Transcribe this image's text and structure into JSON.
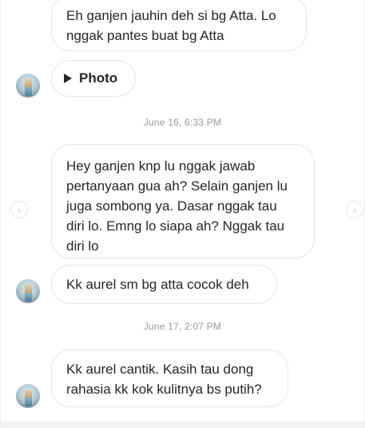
{
  "messages": {
    "m1": {
      "lines": [
        "Eh ganjen jauhin deh si bg Atta. Lo",
        "nggak pantes buat bg Atta"
      ]
    },
    "m2": {
      "label": "Photo"
    },
    "ts1": "June 16, 6:33 PM",
    "m3": {
      "lines": [
        "Hey ganjen knp lu nggak jawab",
        "pertanyaan gua ah? Selain ganjen lu",
        "juga sombong ya. Dasar nggak tau",
        "diri lo. Emng lo siapa ah? Nggak tau",
        "diri lo"
      ]
    },
    "m4": {
      "lines": [
        "Kk aurel sm bg atta cocok deh"
      ]
    },
    "ts2": "June 17, 2:07 PM",
    "m5": {
      "lines": [
        "Kk aurel cantik. Kasih tau dong",
        "rahasia kk kok kulitnya bs putih?"
      ]
    }
  },
  "nav": {
    "prev_icon": "chevron-left-icon",
    "next_icon": "chevron-right-icon",
    "prev_glyph": "‹",
    "next_glyph": "›"
  },
  "colors": {
    "text": "#262626",
    "timestamp": "#999999",
    "bubble_border": "#e6e6e6"
  }
}
